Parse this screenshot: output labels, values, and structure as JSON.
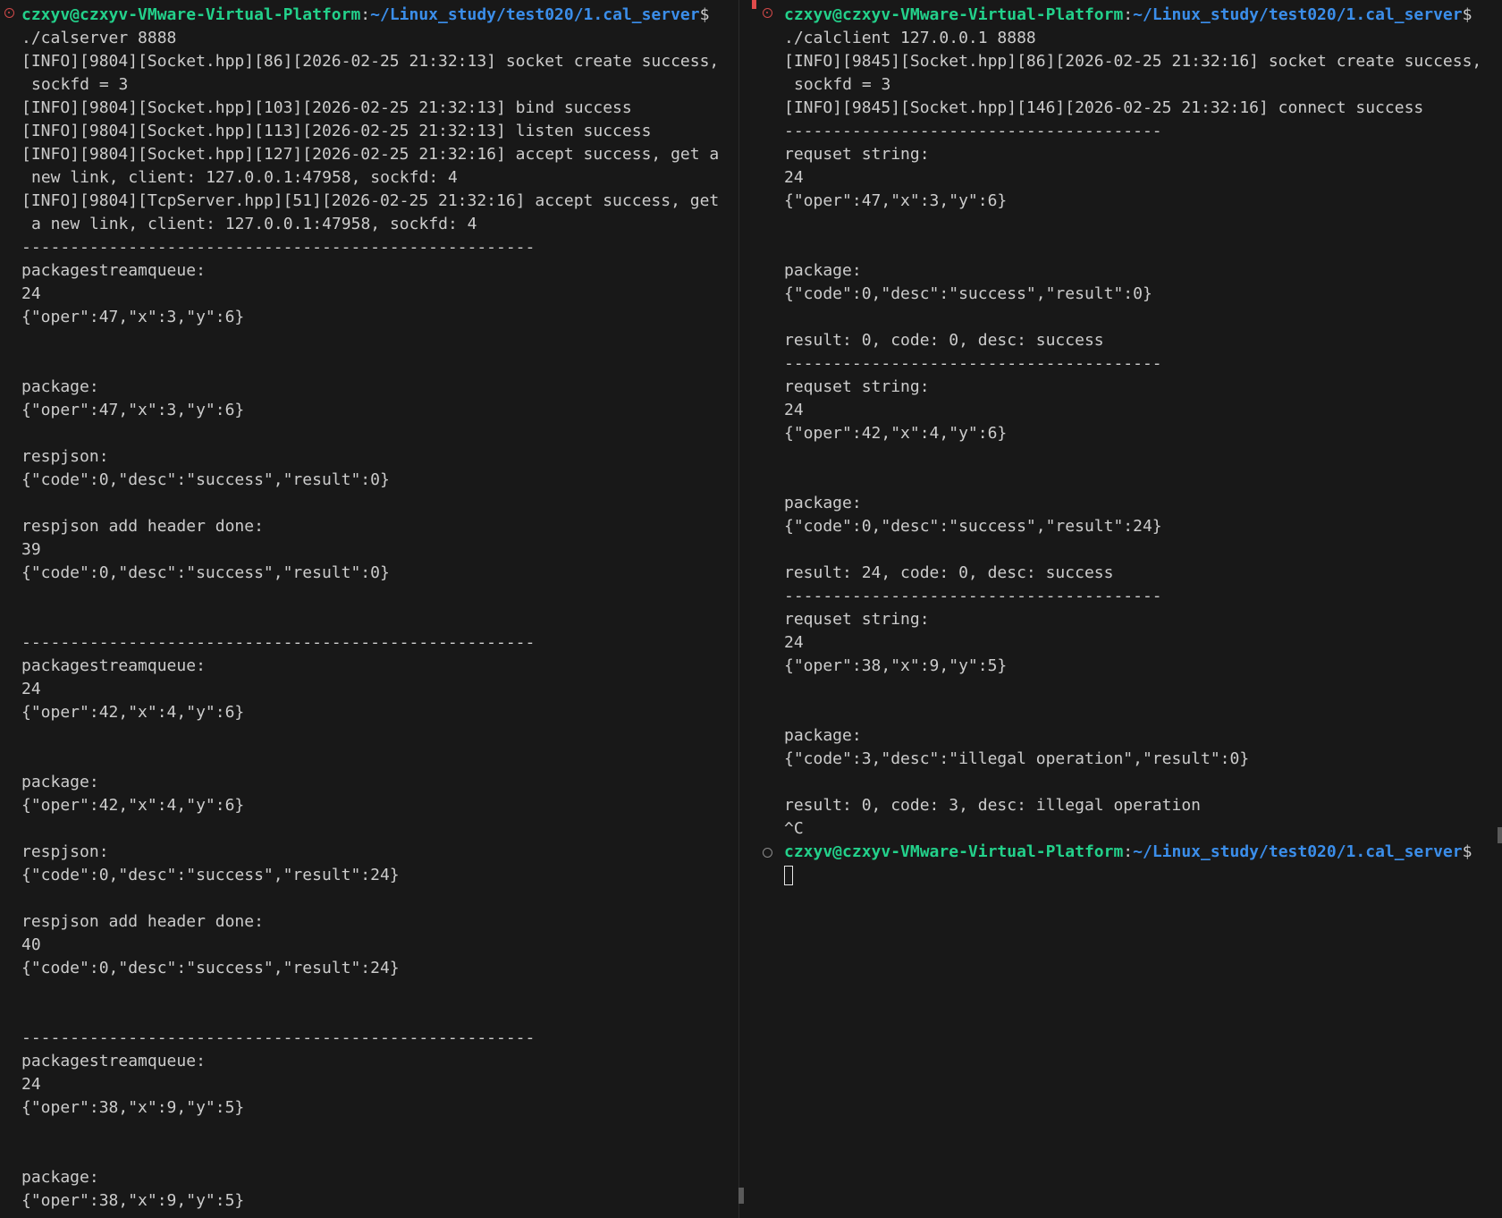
{
  "prompt": {
    "user_host": "czxyv@czxyv-VMware-Virtual-Platform",
    "sep": ":",
    "path": "~/Linux_study/test020/1.cal_server",
    "dollar": "$"
  },
  "left_pane": {
    "lines": [
      {
        "kind": "cmd",
        "text": "./calserver 8888"
      },
      {
        "kind": "text",
        "text": "[INFO][9804][Socket.hpp][86][2026-02-25 21:32:13] socket create success,"
      },
      {
        "kind": "text",
        "indent": true,
        "text": "sockfd = 3"
      },
      {
        "kind": "text",
        "text": "[INFO][9804][Socket.hpp][103][2026-02-25 21:32:13] bind success"
      },
      {
        "kind": "text",
        "text": "[INFO][9804][Socket.hpp][113][2026-02-25 21:32:13] listen success"
      },
      {
        "kind": "text",
        "text": "[INFO][9804][Socket.hpp][127][2026-02-25 21:32:16] accept success, get a"
      },
      {
        "kind": "text",
        "indent": true,
        "text": "new link, client: 127.0.0.1:47958, sockfd: 4"
      },
      {
        "kind": "text",
        "text": "[INFO][9804][TcpServer.hpp][51][2026-02-25 21:32:16] accept success, get"
      },
      {
        "kind": "text",
        "indent": true,
        "text": "a new link, client: 127.0.0.1:47958, sockfd: 4"
      },
      {
        "kind": "text",
        "text": "-----------------------------------------------------"
      },
      {
        "kind": "text",
        "text": "packagestreamqueue:"
      },
      {
        "kind": "text",
        "text": "24"
      },
      {
        "kind": "text",
        "text": "{\"oper\":47,\"x\":3,\"y\":6}"
      },
      {
        "kind": "text",
        "text": ""
      },
      {
        "kind": "text",
        "text": ""
      },
      {
        "kind": "text",
        "text": "package:"
      },
      {
        "kind": "text",
        "text": "{\"oper\":47,\"x\":3,\"y\":6}"
      },
      {
        "kind": "text",
        "text": ""
      },
      {
        "kind": "text",
        "text": "respjson:"
      },
      {
        "kind": "text",
        "text": "{\"code\":0,\"desc\":\"success\",\"result\":0}"
      },
      {
        "kind": "text",
        "text": ""
      },
      {
        "kind": "text",
        "text": "respjson add header done:"
      },
      {
        "kind": "text",
        "text": "39"
      },
      {
        "kind": "text",
        "text": "{\"code\":0,\"desc\":\"success\",\"result\":0}"
      },
      {
        "kind": "text",
        "text": ""
      },
      {
        "kind": "text",
        "text": ""
      },
      {
        "kind": "text",
        "text": "-----------------------------------------------------"
      },
      {
        "kind": "text",
        "text": "packagestreamqueue:"
      },
      {
        "kind": "text",
        "text": "24"
      },
      {
        "kind": "text",
        "text": "{\"oper\":42,\"x\":4,\"y\":6}"
      },
      {
        "kind": "text",
        "text": ""
      },
      {
        "kind": "text",
        "text": ""
      },
      {
        "kind": "text",
        "text": "package:"
      },
      {
        "kind": "text",
        "text": "{\"oper\":42,\"x\":4,\"y\":6}"
      },
      {
        "kind": "text",
        "text": ""
      },
      {
        "kind": "text",
        "text": "respjson:"
      },
      {
        "kind": "text",
        "text": "{\"code\":0,\"desc\":\"success\",\"result\":24}"
      },
      {
        "kind": "text",
        "text": ""
      },
      {
        "kind": "text",
        "text": "respjson add header done:"
      },
      {
        "kind": "text",
        "text": "40"
      },
      {
        "kind": "text",
        "text": "{\"code\":0,\"desc\":\"success\",\"result\":24}"
      },
      {
        "kind": "text",
        "text": ""
      },
      {
        "kind": "text",
        "text": ""
      },
      {
        "kind": "text",
        "text": "-----------------------------------------------------"
      },
      {
        "kind": "text",
        "text": "packagestreamqueue:"
      },
      {
        "kind": "text",
        "text": "24"
      },
      {
        "kind": "text",
        "text": "{\"oper\":38,\"x\":9,\"y\":5}"
      },
      {
        "kind": "text",
        "text": ""
      },
      {
        "kind": "text",
        "text": ""
      },
      {
        "kind": "text",
        "text": "package:"
      },
      {
        "kind": "text",
        "text": "{\"oper\":38,\"x\":9,\"y\":5}"
      }
    ]
  },
  "right_pane": {
    "lines": [
      {
        "kind": "cmd",
        "text": "./calclient 127.0.0.1 8888"
      },
      {
        "kind": "text",
        "text": "[INFO][9845][Socket.hpp][86][2026-02-25 21:32:16] socket create success,"
      },
      {
        "kind": "text",
        "indent": true,
        "text": "sockfd = 3"
      },
      {
        "kind": "text",
        "text": "[INFO][9845][Socket.hpp][146][2026-02-25 21:32:16] connect success"
      },
      {
        "kind": "text",
        "text": "---------------------------------------"
      },
      {
        "kind": "text",
        "text": "requset string:"
      },
      {
        "kind": "text",
        "text": "24"
      },
      {
        "kind": "text",
        "text": "{\"oper\":47,\"x\":3,\"y\":6}"
      },
      {
        "kind": "text",
        "text": ""
      },
      {
        "kind": "text",
        "text": ""
      },
      {
        "kind": "text",
        "text": "package:"
      },
      {
        "kind": "text",
        "text": "{\"code\":0,\"desc\":\"success\",\"result\":0}"
      },
      {
        "kind": "text",
        "text": ""
      },
      {
        "kind": "text",
        "text": "result: 0, code: 0, desc: success"
      },
      {
        "kind": "text",
        "text": "---------------------------------------"
      },
      {
        "kind": "text",
        "text": "requset string:"
      },
      {
        "kind": "text",
        "text": "24"
      },
      {
        "kind": "text",
        "text": "{\"oper\":42,\"x\":4,\"y\":6}"
      },
      {
        "kind": "text",
        "text": ""
      },
      {
        "kind": "text",
        "text": ""
      },
      {
        "kind": "text",
        "text": "package:"
      },
      {
        "kind": "text",
        "text": "{\"code\":0,\"desc\":\"success\",\"result\":24}"
      },
      {
        "kind": "text",
        "text": ""
      },
      {
        "kind": "text",
        "text": "result: 24, code: 0, desc: success"
      },
      {
        "kind": "text",
        "text": "---------------------------------------"
      },
      {
        "kind": "text",
        "text": "requset string:"
      },
      {
        "kind": "text",
        "text": "24"
      },
      {
        "kind": "text",
        "text": "{\"oper\":38,\"x\":9,\"y\":5}"
      },
      {
        "kind": "text",
        "text": ""
      },
      {
        "kind": "text",
        "text": ""
      },
      {
        "kind": "text",
        "text": "package:"
      },
      {
        "kind": "text",
        "text": "{\"code\":3,\"desc\":\"illegal operation\",\"result\":0}"
      },
      {
        "kind": "text",
        "text": ""
      },
      {
        "kind": "text",
        "text": "result: 0, code: 3, desc: illegal operation"
      },
      {
        "kind": "text",
        "text": "^C"
      },
      {
        "kind": "prompt_only",
        "marker": "plain"
      },
      {
        "kind": "cursor"
      }
    ]
  },
  "colors": {
    "background": "#181818",
    "foreground": "#cccccc",
    "prompt_user": "#23d18b",
    "prompt_path": "#3b8eea",
    "error_marker": "#d14949",
    "plain_marker": "#8b8b8b"
  },
  "icons": {
    "error_marker": "circle-x-icon",
    "success_marker": "circle-icon",
    "cursor": "block-cursor-icon"
  }
}
